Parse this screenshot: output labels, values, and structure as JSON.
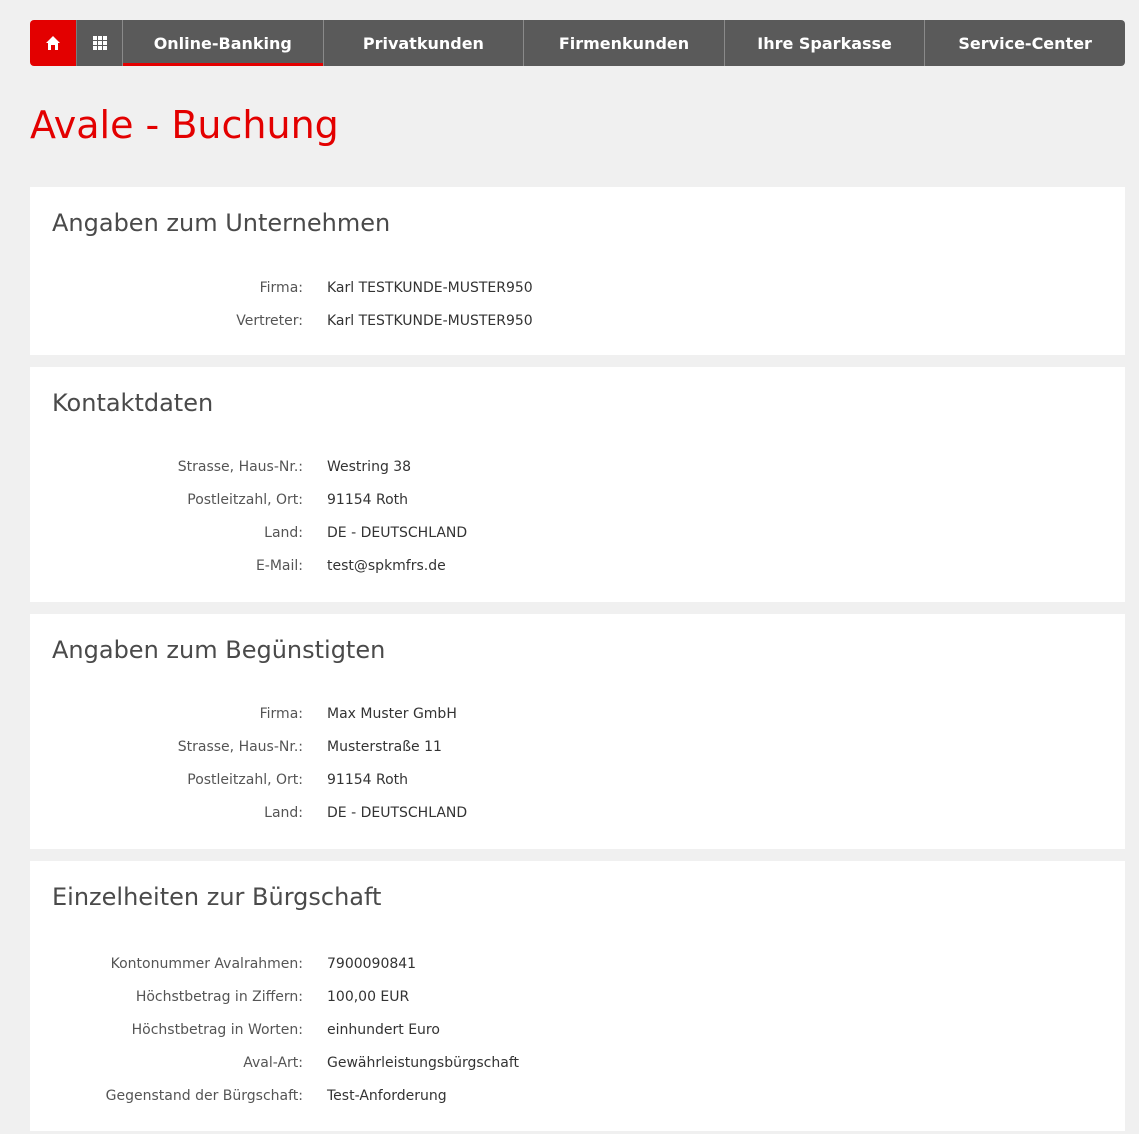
{
  "nav": {
    "items": [
      {
        "label": "Online-Banking"
      },
      {
        "label": "Privatkunden"
      },
      {
        "label": "Firmenkunden"
      },
      {
        "label": "Ihre Sparkasse"
      },
      {
        "label": "Service-Center"
      }
    ],
    "home_icon": "home-icon",
    "apps_icon": "grid-icon"
  },
  "page": {
    "title": "Avale - Buchung"
  },
  "unternehmen": {
    "heading": "Angaben zum Unternehmen",
    "rows": [
      {
        "label": "Firma:",
        "value": "Karl TESTKUNDE-MUSTER950"
      },
      {
        "label": "Vertreter:",
        "value": "Karl TESTKUNDE-MUSTER950"
      }
    ]
  },
  "kontakt": {
    "heading": "Kontaktdaten",
    "rows": [
      {
        "label": "Strasse, Haus-Nr.:",
        "value": "Westring 38"
      },
      {
        "label": "Postleitzahl, Ort:",
        "value": "91154 Roth"
      },
      {
        "label": "Land:",
        "value": "DE - DEUTSCHLAND"
      },
      {
        "label": "E-Mail:",
        "value": "test@spkmfrs.de"
      }
    ]
  },
  "beguenstigter": {
    "heading": "Angaben zum Begünstigten",
    "rows": [
      {
        "label": "Firma:",
        "value": "Max Muster GmbH"
      },
      {
        "label": "Strasse, Haus-Nr.:",
        "value": "Musterstraße 11"
      },
      {
        "label": "Postleitzahl, Ort:",
        "value": "91154 Roth"
      },
      {
        "label": "Land:",
        "value": "DE - DEUTSCHLAND"
      }
    ]
  },
  "buergschaft": {
    "heading": "Einzelheiten zur Bürgschaft",
    "rows": [
      {
        "label": "Kontonummer Avalrahmen:",
        "value": "7900090841"
      },
      {
        "label": "Höchstbetrag in Ziffern:",
        "value": "100,00 EUR"
      },
      {
        "label": "Höchstbetrag in Worten:",
        "value": "einhundert Euro"
      },
      {
        "label": "Aval-Art:",
        "value": "Gewährleistungsbürgschaft"
      },
      {
        "label": "Gegenstand der Bürgschaft:",
        "value": "Test-Anforderung"
      }
    ]
  },
  "colors": {
    "accent": "#e30000",
    "nav_bg": "#5a5a5a",
    "page_bg": "#f0f0f0"
  }
}
